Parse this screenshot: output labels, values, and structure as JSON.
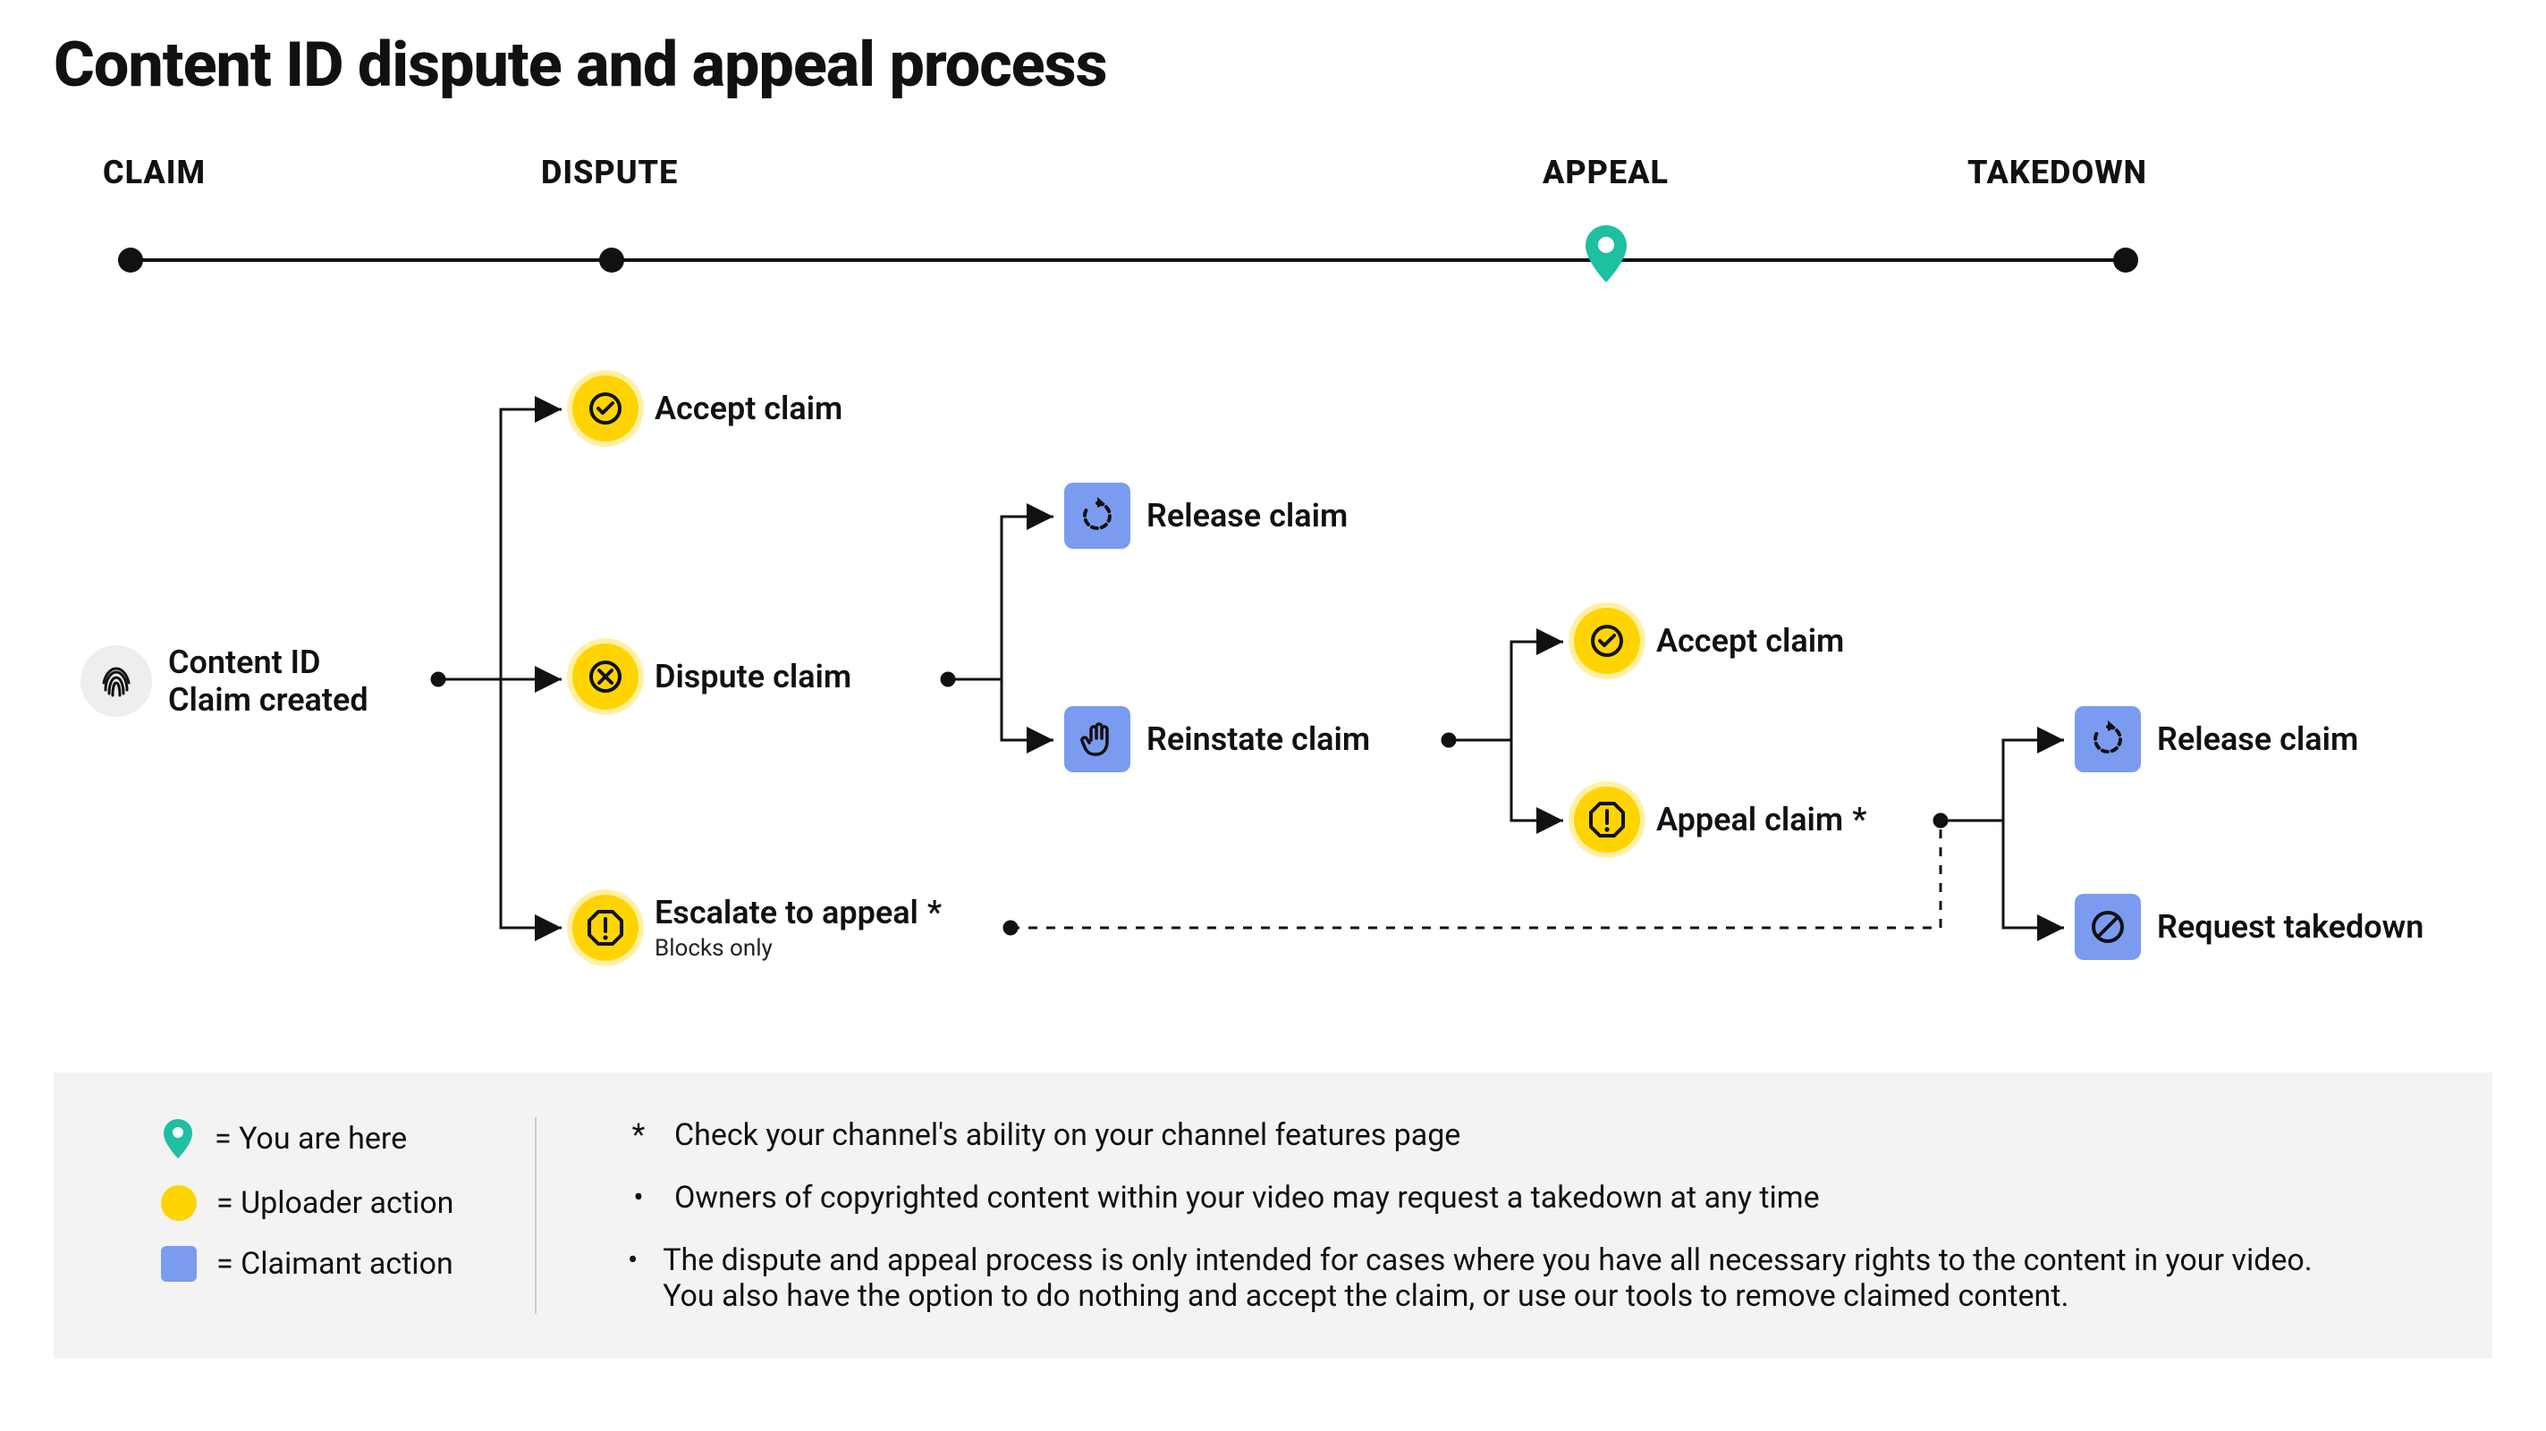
{
  "title": "Content ID dispute and appeal process",
  "timeline": {
    "claim": "CLAIM",
    "dispute": "DISPUTE",
    "appeal": "APPEAL",
    "takedown": "TAKEDOWN"
  },
  "nodes": {
    "start_line1": "Content ID",
    "start_line2": "Claim created",
    "accept_claim": "Accept claim",
    "dispute_claim": "Dispute claim",
    "escalate_appeal": "Escalate to appeal",
    "escalate_star": "*",
    "escalate_sub": "Blocks only",
    "release_claim": "Release claim",
    "reinstate_claim": "Reinstate claim",
    "accept_claim_2": "Accept claim",
    "appeal_claim": "Appeal claim",
    "appeal_star": "*",
    "release_claim_2": "Release claim",
    "request_takedown": "Request takedown"
  },
  "legend": {
    "you_are_here": "= You are here",
    "uploader_action": "= Uploader action",
    "claimant_action": "= Claimant action",
    "star_note": "Check your channel's ability on your channel features page",
    "note1": "Owners of copyrighted content within your video may request a takedown at any time",
    "note2": "The dispute and appeal process is only intended for cases where you have all necessary rights to the content in your video. You also have the option to do nothing and accept the claim, or use our tools to remove claimed content."
  },
  "colors": {
    "yellow": "#ffd400",
    "blue": "#7a9bf0",
    "teal": "#1fbfa2",
    "gray_bg": "#f3f3f3"
  }
}
